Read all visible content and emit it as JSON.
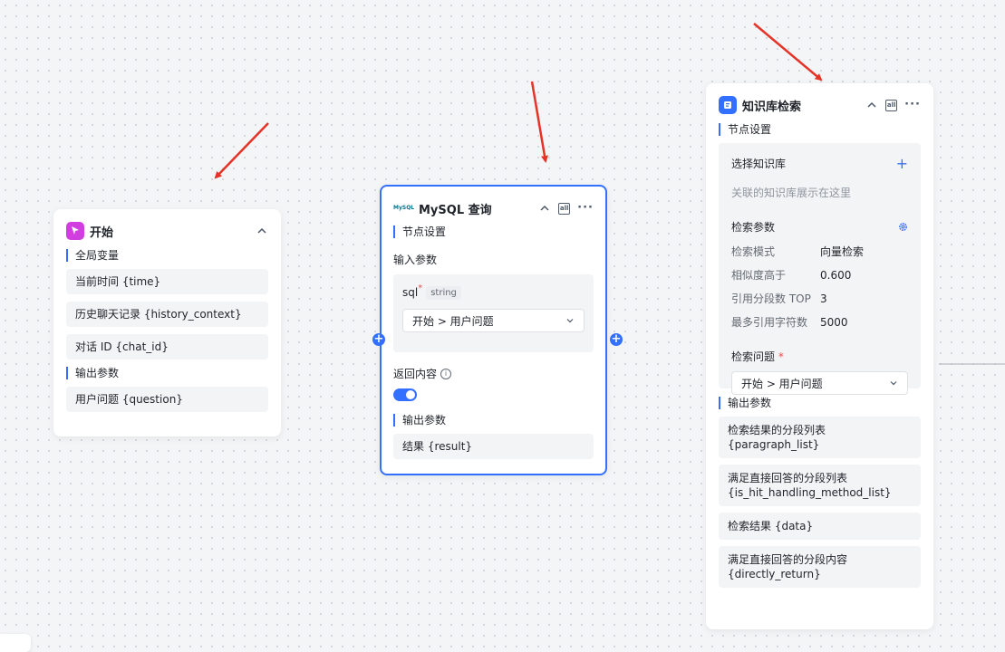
{
  "colors": {
    "accent": "#3370ff",
    "arrow": "#e53427",
    "start_icon_bg": "#d13ee0",
    "kb_icon_bg": "#3370ff"
  },
  "start_node": {
    "title": "开始",
    "icon": "cursor-icon",
    "global_vars_title": "全局变量",
    "global_vars": [
      "当前时间 {time}",
      "历史聊天记录 {history_context}",
      "对话 ID {chat_id}"
    ],
    "output_title": "输出参数",
    "outputs": [
      "用户问题 {question}"
    ]
  },
  "mysql_node": {
    "title": "MySQL 查询",
    "logo_text": "MySQL",
    "all_label": "all",
    "node_settings": "节点设置",
    "input_params": "输入参数",
    "param_name": "sql",
    "param_required": "*",
    "param_type": "string",
    "param_value": "开始 > 用户问题",
    "return_content": "返回内容",
    "return_info_icon": "info-icon",
    "toggle_on": true,
    "output_title": "输出参数",
    "outputs": [
      "结果 {result}"
    ]
  },
  "kb_node": {
    "title": "知识库检索",
    "all_label": "all",
    "node_settings": "节点设置",
    "select_kb": "选择知识库",
    "kb_placeholder": "关联的知识库展示在这里",
    "search_params": "检索参数",
    "params": [
      {
        "key": "检索模式",
        "value": "向量检索"
      },
      {
        "key": "相似度高于",
        "value": "0.600"
      },
      {
        "key": "引用分段数 TOP",
        "value": "3"
      },
      {
        "key": "最多引用字符数",
        "value": "5000"
      }
    ],
    "search_question": "检索问题",
    "search_question_required": "*",
    "search_question_value": "开始 > 用户问题",
    "output_title": "输出参数",
    "outputs": [
      {
        "line1": "检索结果的分段列表",
        "line2": "{paragraph_list}"
      },
      {
        "line1": "满足直接回答的分段列表",
        "line2": "{is_hit_handling_method_list}"
      },
      {
        "line1": "检索结果 {data}",
        "line2": ""
      },
      {
        "line1": "满足直接回答的分段内容",
        "line2": "{directly_return}"
      }
    ]
  }
}
